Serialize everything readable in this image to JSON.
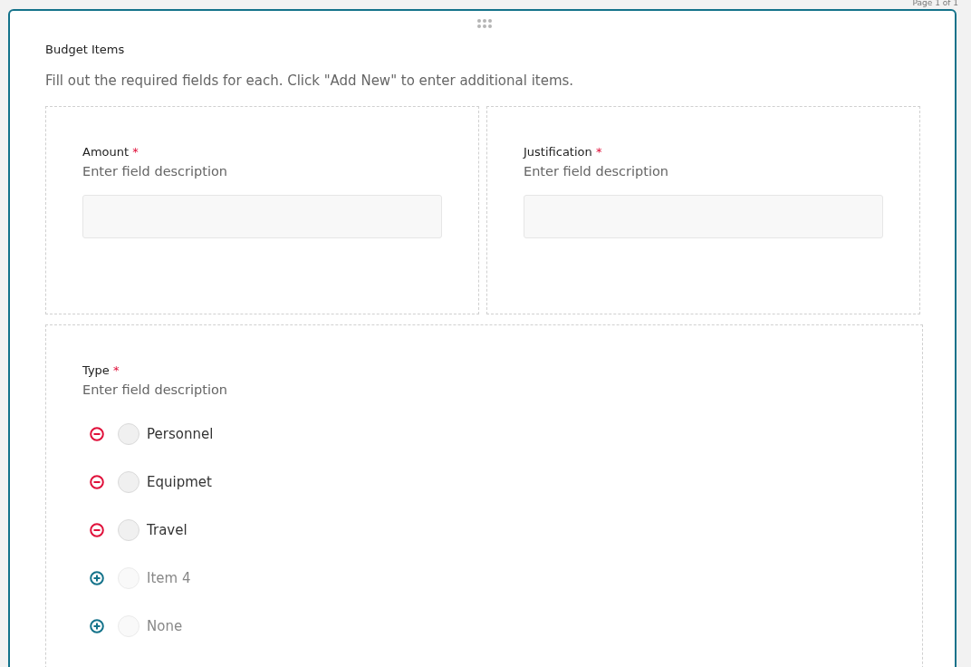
{
  "page_indicator": "Page 1 of 1",
  "section": {
    "title": "Budget Items",
    "instructions": "Fill out the required fields for each. Click \"Add New\" to enter additional items."
  },
  "fields": [
    {
      "label": "Amount",
      "required_mark": "*",
      "description": "Enter field description"
    },
    {
      "label": "Justification",
      "required_mark": "*",
      "description": "Enter field description"
    }
  ],
  "type_field": {
    "label": "Type",
    "required_mark": "*",
    "description": "Enter field description",
    "options": [
      {
        "kind": "remove",
        "label": "Personnel",
        "disabled": false,
        "selected": false
      },
      {
        "kind": "remove",
        "label": "Equipmet",
        "disabled": false,
        "selected": false
      },
      {
        "kind": "remove",
        "label": "Travel",
        "disabled": false,
        "selected": false
      },
      {
        "kind": "add",
        "label": "Item 4",
        "disabled": true,
        "selected": false
      },
      {
        "kind": "add",
        "label": "None",
        "disabled": true,
        "selected": false
      }
    ]
  }
}
